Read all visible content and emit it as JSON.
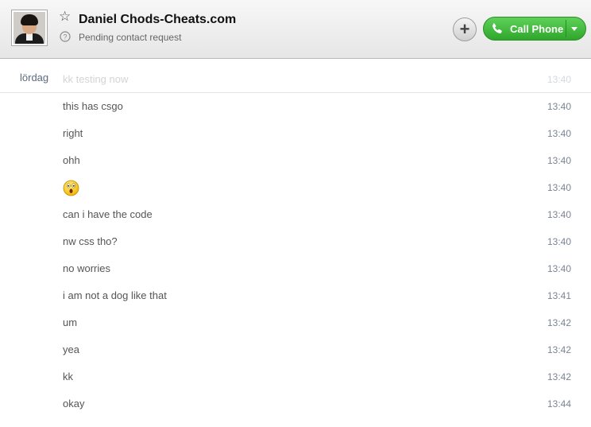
{
  "contact": {
    "name": "Daniel Chods-Cheats.com",
    "status": "Pending contact request"
  },
  "toolbar": {
    "call_label": "Call Phone",
    "add_symbol": "+"
  },
  "conversation": {
    "day_label": "lördag",
    "messages": [
      {
        "text": "kk testing now",
        "time": "13:40",
        "faded": true
      },
      {
        "text": "this has csgo",
        "time": "13:40"
      },
      {
        "text": "right",
        "time": "13:40"
      },
      {
        "text": "ohh",
        "time": "13:40"
      },
      {
        "text": "",
        "icon": "shocked-emoji-icon",
        "time": "13:40"
      },
      {
        "text": "can i have the code",
        "time": "13:40"
      },
      {
        "text": "nw css tho?",
        "time": "13:40"
      },
      {
        "text": "no worries",
        "time": "13:40"
      },
      {
        "text": "i am not a dog like that",
        "time": "13:41"
      },
      {
        "text": "um",
        "time": "13:42"
      },
      {
        "text": "yea",
        "time": "13:42"
      },
      {
        "text": "kk",
        "time": "13:42"
      },
      {
        "text": "okay",
        "time": "13:44"
      }
    ]
  },
  "colors": {
    "call_green": "#3cb837",
    "timestamp": "#7a8494",
    "day_label": "#5a6a80"
  }
}
